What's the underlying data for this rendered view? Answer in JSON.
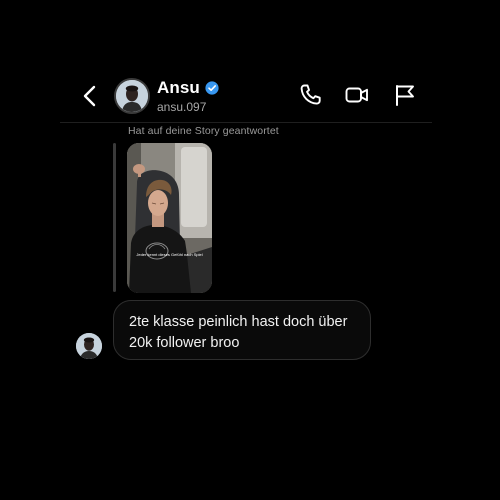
{
  "header": {
    "name": "Ansu",
    "handle": "ansu.097",
    "verified": true,
    "icons": {
      "back": "chevron-left-icon",
      "verified": "verified-badge-icon",
      "call": "phone-icon",
      "video": "video-camera-icon",
      "report": "flag-icon"
    }
  },
  "conversation": {
    "story_reply_note": "Hat auf deine Story geantwortet",
    "story_caption": "Jeder kennt dieses Gefühl nach Spiel",
    "message": {
      "line1": "2te klasse peinlich hast doch über",
      "line2": "20k follower broo"
    }
  },
  "colors": {
    "background": "#000000",
    "verified_badge": "#3897f0",
    "secondary_text": "#a8a8a8",
    "bubble_border": "#2e2e2e"
  }
}
